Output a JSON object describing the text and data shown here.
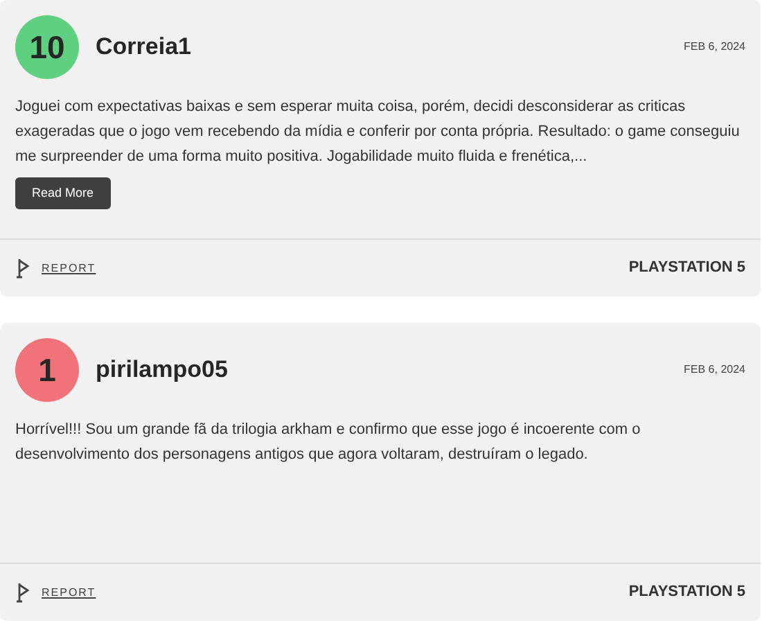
{
  "reviews": [
    {
      "score": "10",
      "color": "#5fcf80",
      "author": "Correia1",
      "date": "FEB 6, 2024",
      "text": "Joguei com expectativas baixas e sem esperar muita coisa, porém, decidi desconsiderar as criticas exageradas que o jogo vem recebendo da mídia e conferir por conta própria. Resultado: o game conseguiu me surpreender de uma forma muito positiva. Jogabilidade muito fluida e frenética,...",
      "read_more": "Read More",
      "report": "REPORT",
      "platform": "PLAYSTATION 5"
    },
    {
      "score": "1",
      "color": "#f0737a",
      "author": "pirilampo05",
      "date": "FEB 6, 2024",
      "text": "Horrível!!! Sou um grande fã da trilogia arkham e confirmo que esse jogo é incoerente com o desenvolvimento dos personagens antigos que agora voltaram, destruíram o legado.",
      "report": "REPORT",
      "platform": "PLAYSTATION 5"
    }
  ]
}
